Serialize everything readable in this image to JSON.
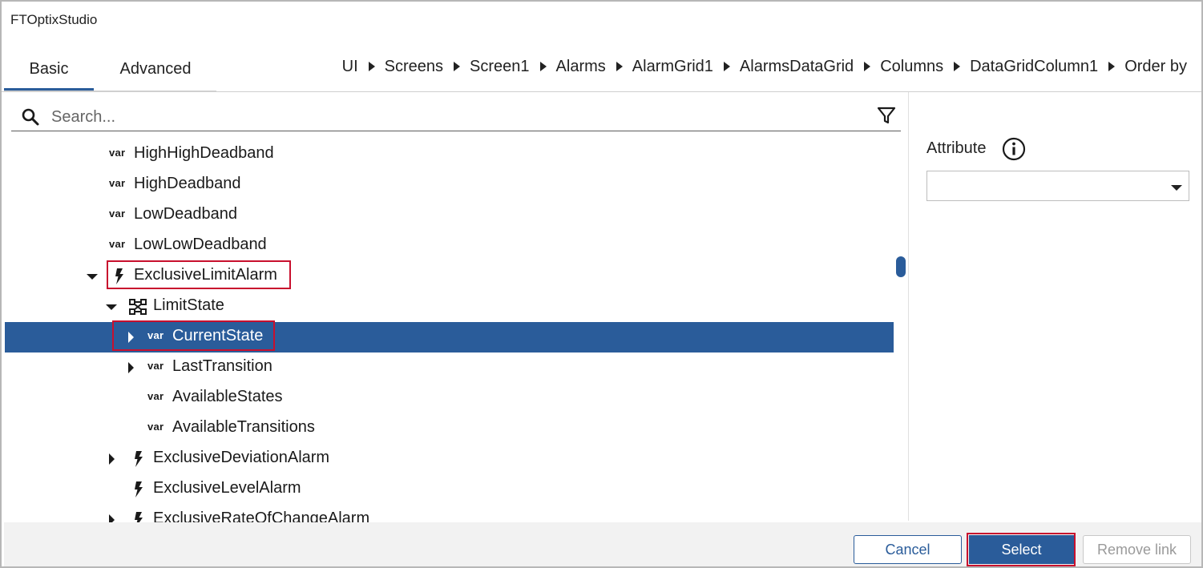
{
  "window": {
    "title": "FTOptixStudio"
  },
  "tabs": [
    {
      "label": "Basic",
      "active": true
    },
    {
      "label": "Advanced",
      "active": false
    }
  ],
  "breadcrumb": [
    "UI",
    "Screens",
    "Screen1",
    "Alarms",
    "AlarmGrid1",
    "AlarmsDataGrid",
    "Columns",
    "DataGridColumn1",
    "Order by"
  ],
  "search": {
    "placeholder": "Search...",
    "value": ""
  },
  "tree": {
    "var_tag": "var",
    "items": [
      {
        "label": "HighHighDeadband",
        "icon": "var"
      },
      {
        "label": "HighDeadband",
        "icon": "var"
      },
      {
        "label": "LowDeadband",
        "icon": "var"
      },
      {
        "label": "LowLowDeadband",
        "icon": "var"
      },
      {
        "label": "ExclusiveLimitAlarm",
        "icon": "lightning-icon",
        "expanded": true
      },
      {
        "label": "LimitState",
        "icon": "state-machine-icon",
        "expanded": true
      },
      {
        "label": "CurrentState",
        "icon": "var",
        "expandable": true,
        "selected": true
      },
      {
        "label": "LastTransition",
        "icon": "var",
        "expandable": true
      },
      {
        "label": "AvailableStates",
        "icon": "var"
      },
      {
        "label": "AvailableTransitions",
        "icon": "var"
      },
      {
        "label": "ExclusiveDeviationAlarm",
        "icon": "lightning-icon",
        "expandable": true
      },
      {
        "label": "ExclusiveLevelAlarm",
        "icon": "lightning-icon"
      },
      {
        "label": "ExclusiveRateOfChangeAlarm",
        "icon": "lightning-icon",
        "expandable": true
      }
    ]
  },
  "attribute": {
    "label": "Attribute",
    "value": ""
  },
  "footer": {
    "cancel": "Cancel",
    "select": "Select",
    "remove": "Remove link"
  },
  "colors": {
    "accent": "#2a5c9a",
    "highlight": "#c8102e"
  }
}
